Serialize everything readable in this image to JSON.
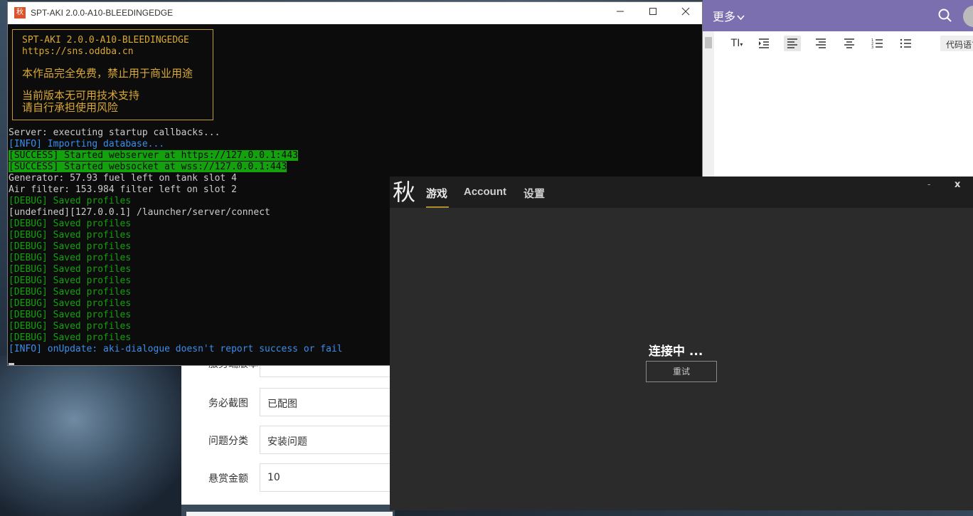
{
  "forum": {
    "rows": [
      {
        "label": "服务端版本",
        "value": ""
      },
      {
        "label": "务必截图",
        "value": "已配图"
      },
      {
        "label": "问题分类",
        "value": "安装问题"
      },
      {
        "label": "悬赏金额",
        "value": "10"
      }
    ]
  },
  "editor": {
    "more_label": "更多",
    "toolbar": {
      "font_size": "TI",
      "code_language": "代码语言"
    }
  },
  "console": {
    "title": "SPT-AKI 2.0.0-A10-BLEEDINGEDGE",
    "icon_glyph": "秋",
    "banner": {
      "line1": "SPT-AKI 2.0.0-A10-BLEEDINGEDGE",
      "line2": "https://sns.oddba.cn",
      "line3": "本作品完全免费，禁止用于商业用途",
      "line4": "当前版本无可用技术支持",
      "line5": "请自行承担使用风险"
    },
    "log": [
      {
        "type": "plain",
        "text": "Server: executing startup callbacks..."
      },
      {
        "type": "info",
        "text": "[INFO] Importing database..."
      },
      {
        "type": "success",
        "text": "[SUCCESS] Started webserver at https://127.0.0.1:443"
      },
      {
        "type": "success",
        "text": "[SUCCESS] Started websocket at wss://127.0.0.1:443"
      },
      {
        "type": "plain",
        "text": "Generator: 57.93 fuel left on tank slot 4"
      },
      {
        "type": "plain",
        "text": "Air filter: 153.984 filter left on slot 2"
      },
      {
        "type": "debug",
        "text": "[DEBUG] Saved profiles"
      },
      {
        "type": "plain",
        "text": "[undefined][127.0.0.1] /launcher/server/connect"
      },
      {
        "type": "debug",
        "text": "[DEBUG] Saved profiles"
      },
      {
        "type": "debug",
        "text": "[DEBUG] Saved profiles"
      },
      {
        "type": "debug",
        "text": "[DEBUG] Saved profiles"
      },
      {
        "type": "debug",
        "text": "[DEBUG] Saved profiles"
      },
      {
        "type": "debug",
        "text": "[DEBUG] Saved profiles"
      },
      {
        "type": "debug",
        "text": "[DEBUG] Saved profiles"
      },
      {
        "type": "debug",
        "text": "[DEBUG] Saved profiles"
      },
      {
        "type": "debug",
        "text": "[DEBUG] Saved profiles"
      },
      {
        "type": "debug",
        "text": "[DEBUG] Saved profiles"
      },
      {
        "type": "debug",
        "text": "[DEBUG] Saved profiles"
      },
      {
        "type": "debug",
        "text": "[DEBUG] Saved profiles"
      },
      {
        "type": "info",
        "text": "[INFO] onUpdate: aki-dialogue doesn't report success or fail"
      }
    ]
  },
  "launcher": {
    "logo": "秋",
    "tabs": [
      "游戏",
      "Account",
      "设置"
    ],
    "minimize": "-",
    "close": "x",
    "status": "连接中 ...",
    "retry_label": "重试"
  },
  "colors": {
    "console_bg": "#0c0c0c",
    "info": "#3b8eea",
    "debug": "#13a10e",
    "success_bg": "#13a10e",
    "banner": "#d9a835",
    "launcher_bg": "#2b2b2b",
    "editor_header": "#7b6fb0"
  },
  "icons": [
    "app-icon",
    "minimize-icon",
    "maximize-icon",
    "close-icon",
    "search-icon",
    "chevron-down-icon",
    "indent-icon",
    "align-left-icon",
    "align-right-icon",
    "align-center-icon",
    "ordered-list-icon",
    "unordered-list-icon"
  ]
}
